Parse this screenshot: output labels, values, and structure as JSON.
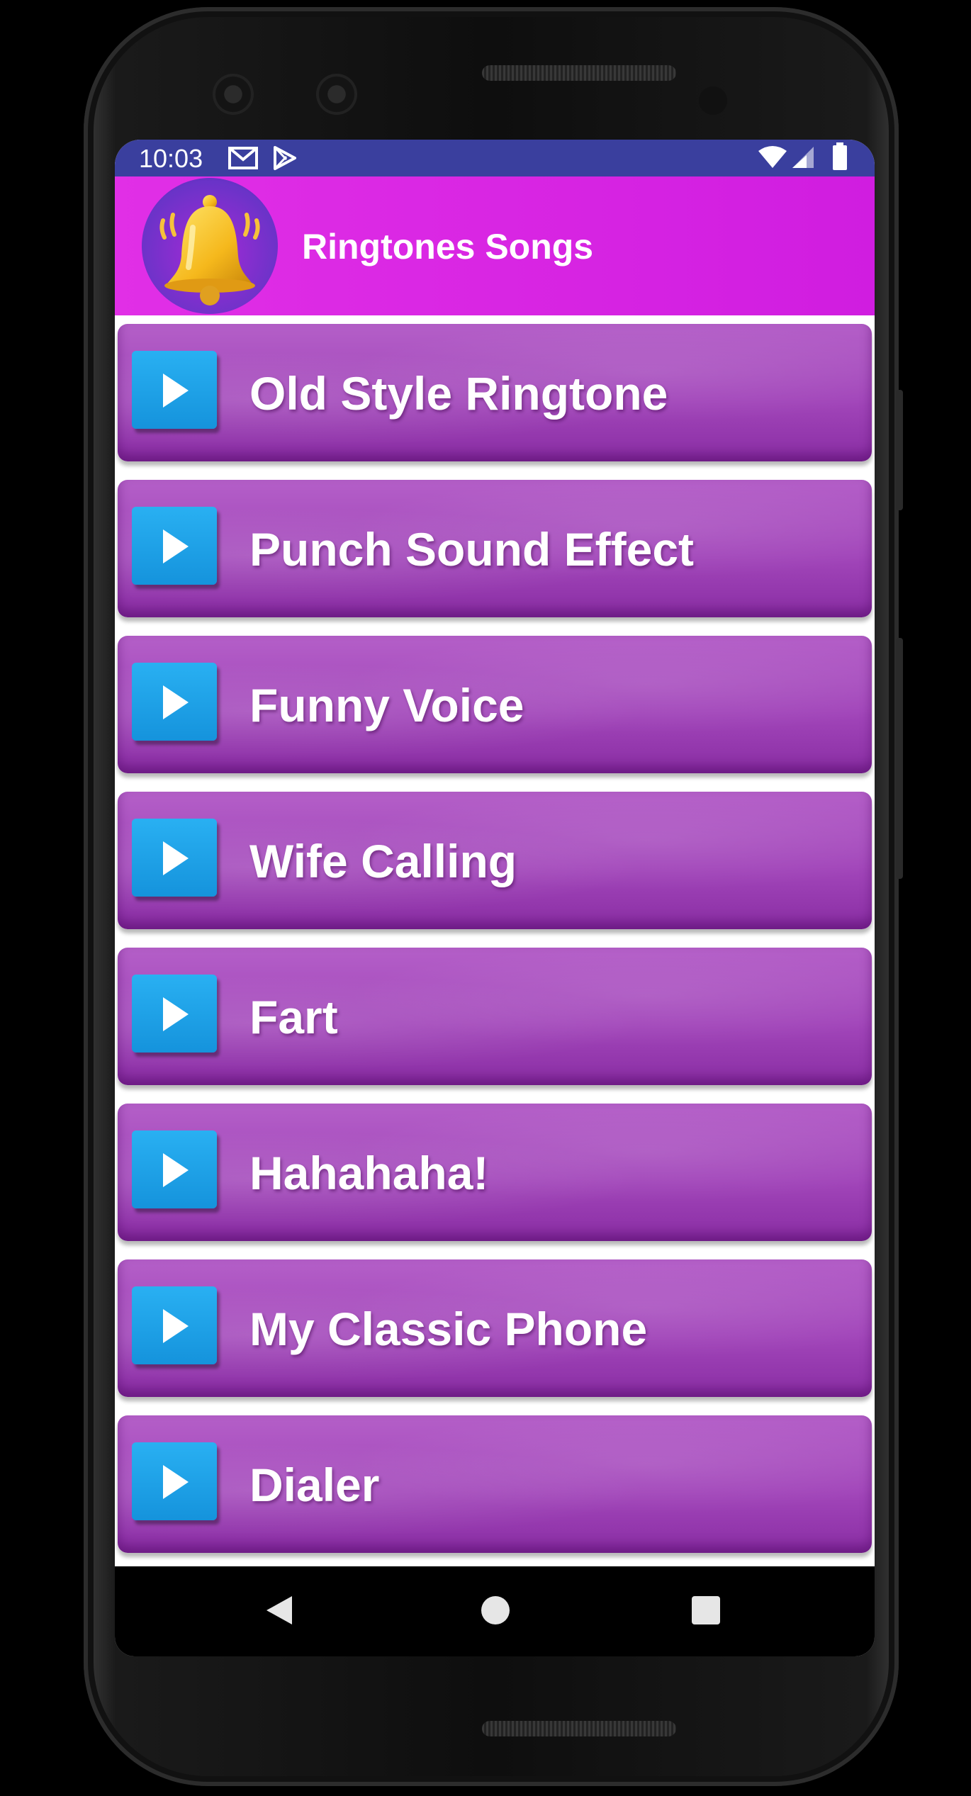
{
  "status_bar": {
    "time": "10:03",
    "left_icons": [
      "gmail-icon",
      "play-store-icon"
    ],
    "right_icons": [
      "wifi-icon",
      "signal-icon",
      "battery-icon"
    ]
  },
  "app_bar": {
    "title": "Ringtones Songs",
    "logo_icon": "bell-icon"
  },
  "ringtones": [
    {
      "label": "Old Style Ringtone",
      "icon": "play-icon"
    },
    {
      "label": "Punch Sound Effect",
      "icon": "play-icon"
    },
    {
      "label": "Funny Voice",
      "icon": "play-icon"
    },
    {
      "label": "Wife Calling",
      "icon": "play-icon"
    },
    {
      "label": "Fart",
      "icon": "play-icon"
    },
    {
      "label": "Hahahaha!",
      "icon": "play-icon"
    },
    {
      "label": "My Classic Phone",
      "icon": "play-icon"
    },
    {
      "label": "Dialer",
      "icon": "play-icon"
    }
  ],
  "nav_bar": {
    "buttons": [
      "back-icon",
      "home-icon",
      "recents-icon"
    ]
  },
  "colors": {
    "status_bar": "#3a3f9e",
    "app_bar": "#d01de0",
    "item_background": "#a246ba",
    "play_button": "#1c9fe6"
  }
}
